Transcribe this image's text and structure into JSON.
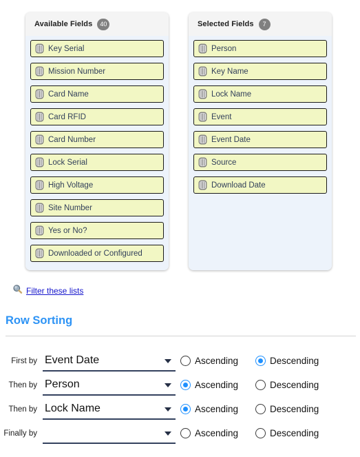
{
  "available_panel": {
    "title": "Available Fields",
    "count": "40",
    "icon": "column-icon",
    "items": [
      {
        "label": "Key Serial"
      },
      {
        "label": "Mission Number"
      },
      {
        "label": "Card Name"
      },
      {
        "label": "Card RFID"
      },
      {
        "label": "Card Number"
      },
      {
        "label": "Lock Serial"
      },
      {
        "label": "High Voltage"
      },
      {
        "label": "Site Number"
      },
      {
        "label": "Yes or No?"
      },
      {
        "label": "Downloaded or Configured"
      }
    ]
  },
  "selected_panel": {
    "title": "Selected Fields",
    "count": "7",
    "icon": "column-icon",
    "items": [
      {
        "label": "Person"
      },
      {
        "label": "Key Name"
      },
      {
        "label": "Lock Name"
      },
      {
        "label": "Event"
      },
      {
        "label": "Event Date"
      },
      {
        "label": "Source"
      },
      {
        "label": "Download Date"
      }
    ]
  },
  "filter": {
    "icon": "magnifier-icon",
    "label": "Filter these lists"
  },
  "row_sorting": {
    "title": "Row Sorting",
    "ascending_label": "Ascending",
    "descending_label": "Descending",
    "rows": [
      {
        "label": "First by",
        "value": "Event Date",
        "direction": "descending"
      },
      {
        "label": "Then by",
        "value": "Person",
        "direction": "ascending"
      },
      {
        "label": "Then by",
        "value": "Lock Name",
        "direction": "ascending"
      },
      {
        "label": "Finally by",
        "value": "",
        "direction": "none"
      }
    ]
  },
  "colors": {
    "accent_heading": "#2d93f5",
    "field_chip": "#f2f7c4",
    "list_background": "#edf3fb",
    "panel_background": "#f4f4f4",
    "badge": "#808080",
    "radio_selected": "#1e90ff",
    "link": "#1515cc",
    "select_underline": "#33415e"
  }
}
